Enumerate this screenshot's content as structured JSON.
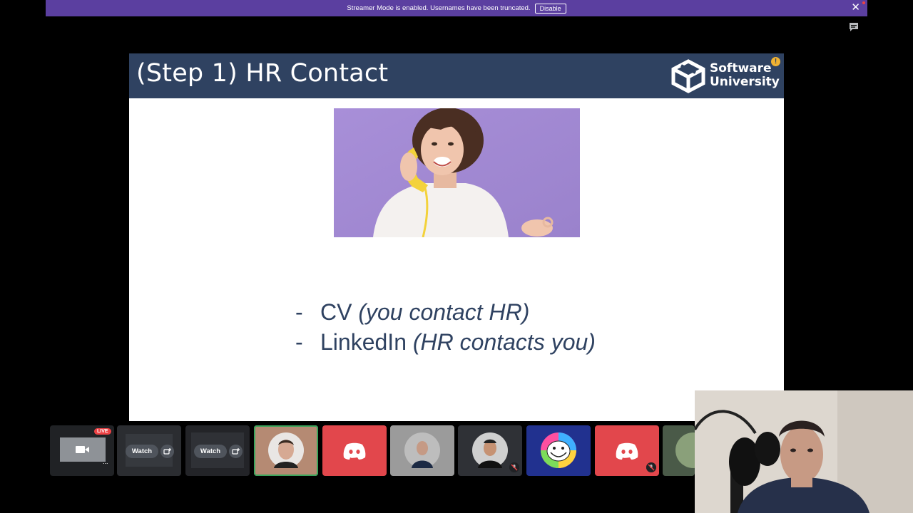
{
  "banner": {
    "message": "Streamer Mode is enabled. Usernames have been truncated.",
    "disable_label": "Disable",
    "close_icon": "close-icon"
  },
  "slide": {
    "title": "(Step 1) HR Contact",
    "logo_line1": "Software",
    "logo_line2": "University",
    "alert_glyph": "!",
    "bullets": [
      {
        "dash": "-",
        "main": "CV",
        "italic": "(you contact HR)"
      },
      {
        "dash": "-",
        "main": "LinkedIn",
        "italic": "(HR contacts you)"
      }
    ]
  },
  "tiles": {
    "live_label": "LIVE",
    "watch_label_1": "Watch",
    "watch_label_2": "Watch",
    "more_glyph": "..."
  },
  "colors": {
    "banner": "#5b3fa0",
    "slide_header": "#2f4261",
    "discord_red": "#e2474c",
    "discord_blue": "#1e3a8a"
  }
}
